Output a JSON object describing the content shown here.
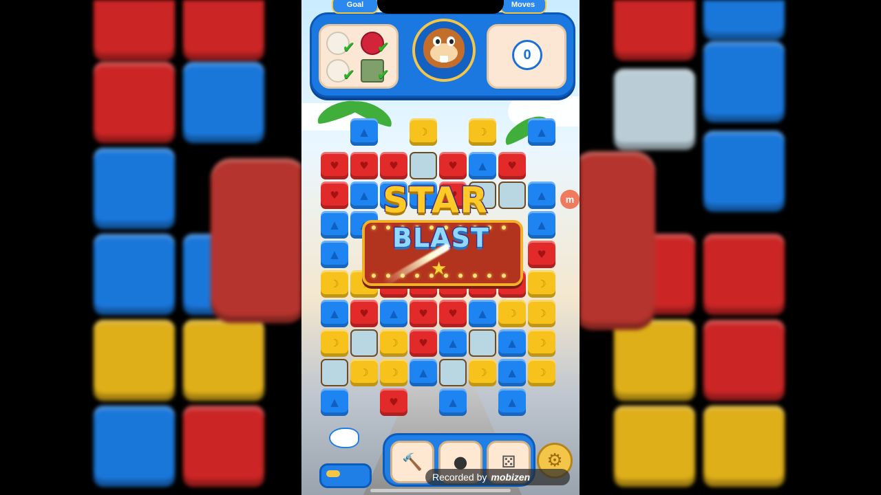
{
  "hud": {
    "goal_label": "Goal",
    "moves_label": "Moves",
    "moves_value": "0",
    "goals": [
      {
        "icon": "bone-icon",
        "completed": true
      },
      {
        "icon": "pomegranate-icon",
        "completed": true
      },
      {
        "icon": "bubble-icon",
        "completed": true
      },
      {
        "icon": "crate-icon",
        "completed": true
      }
    ],
    "avatar": "beaver-character"
  },
  "banner": {
    "line1": "STAR",
    "line2": "BLAST"
  },
  "board": {
    "columns": 8,
    "rows": [
      [
        "",
        "blue",
        "",
        "yellow",
        "",
        "yellow",
        "",
        "blue"
      ],
      [
        "red",
        "red",
        "red",
        "empty",
        "red",
        "blue",
        "red",
        ""
      ],
      [
        "red",
        "blue",
        "blue",
        "blue",
        "red",
        "empty",
        "empty",
        "blue"
      ],
      [
        "blue",
        "blue",
        "",
        "",
        "",
        "",
        "",
        "blue"
      ],
      [
        "blue",
        "",
        "",
        "",
        "",
        "",
        "",
        "red"
      ],
      [
        "yellow",
        "yellow",
        "red",
        "red",
        "red",
        "red",
        "red",
        "yellow"
      ],
      [
        "blue",
        "red",
        "blue",
        "red",
        "red",
        "blue",
        "yellow",
        "yellow"
      ],
      [
        "yellow",
        "empty",
        "yellow",
        "red",
        "blue",
        "empty",
        "blue",
        "yellow"
      ],
      [
        "empty",
        "yellow",
        "yellow",
        "blue",
        "empty",
        "yellow",
        "blue",
        "yellow"
      ],
      [
        "blue",
        "",
        "red",
        "",
        "blue",
        "",
        "blue",
        ""
      ]
    ]
  },
  "boosters": [
    {
      "name": "hammer-booster",
      "icon": "hammer-icon"
    },
    {
      "name": "bomb-booster",
      "icon": "bomb-icon"
    },
    {
      "name": "dice-booster",
      "icon": "dice-icon"
    }
  ],
  "side_badge": "m",
  "watermark": {
    "prefix": "Recorded by",
    "brand": "mobizen"
  }
}
